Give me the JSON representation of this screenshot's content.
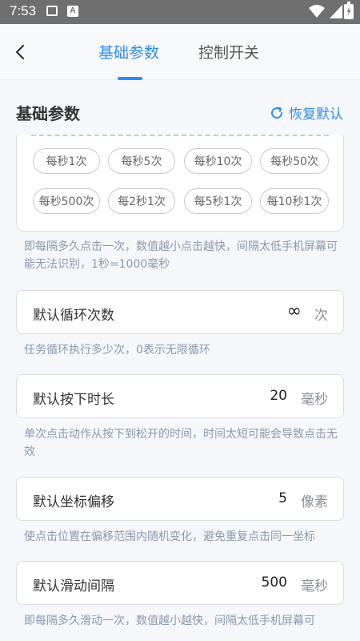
{
  "status_bar": {
    "time": "7:53",
    "icons": [
      "image-icon",
      "a-notification-icon",
      "wifi-icon",
      "cellular-icon",
      "battery-charging-icon"
    ]
  },
  "header": {
    "back_icon": "chevron-left-icon",
    "tabs": [
      {
        "label": "基础参数",
        "active": true
      },
      {
        "label": "控制开关",
        "active": false
      }
    ],
    "accent_color": "#2e8cf0"
  },
  "section": {
    "title": "基础参数",
    "reset_label": "恢复默认",
    "reset_icon": "refresh-icon"
  },
  "presets": {
    "rows": [
      [
        "每秒1次",
        "每秒5次",
        "每秒10次",
        "每秒50次"
      ],
      [
        "每秒500次",
        "每2秒1次",
        "每5秒1次",
        "每10秒1次"
      ]
    ]
  },
  "hints": {
    "interval": "即每隔多久点击一次，数值越小点击越快，间隔太低手机屏幕可能无法识别，1秒=1000毫秒",
    "loop": "任务循环执行多少次，0表示无限循环",
    "press": "单次点击动作从按下到松开的时间，时间太短可能会导致点击无效",
    "offset": "使点击位置在偏移范围内随机变化，避免重复点击同一坐标",
    "swipe": "即每隔多久滑动一次，数值越小越快，间隔太低手机屏幕可"
  },
  "fields": {
    "loop": {
      "label": "默认循环次数",
      "value": "∞",
      "unit": "次"
    },
    "press": {
      "label": "默认按下时长",
      "value": "20",
      "unit": "毫秒"
    },
    "offset": {
      "label": "默认坐标偏移",
      "value": "5",
      "unit": "像素"
    },
    "swipe": {
      "label": "默认滑动间隔",
      "value": "500",
      "unit": "毫秒"
    }
  }
}
